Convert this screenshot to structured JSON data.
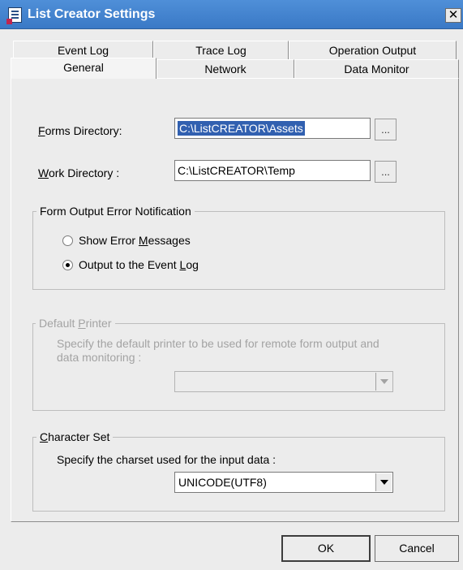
{
  "window": {
    "title": "List Creator Settings",
    "close_symbol": "✕"
  },
  "icons": {
    "app": "list-creator-app-icon",
    "close": "close-icon"
  },
  "tabs": {
    "row_back": [
      {
        "label": "Event Log"
      },
      {
        "label": "Trace Log"
      },
      {
        "label": "Operation Output"
      }
    ],
    "row_front": [
      {
        "label": "General",
        "active": true
      },
      {
        "label": "Network"
      },
      {
        "label": "Data Monitor"
      }
    ]
  },
  "general": {
    "forms_directory": {
      "label_accel": "F",
      "label_rest": "orms Directory:",
      "value": "C:\\ListCREATOR\\Assets",
      "browse": "..."
    },
    "work_directory": {
      "label_accel": "W",
      "label_rest": "ork Directory :",
      "value": "C:\\ListCREATOR\\Temp",
      "browse": "..."
    },
    "error_notification": {
      "title": "Form Output Error Notification",
      "options": [
        {
          "label_pre": "Show Error ",
          "accel": "M",
          "label_post": "essages",
          "checked": false
        },
        {
          "label_pre": "Output to the Event ",
          "accel": "L",
          "label_post": "og",
          "checked": true
        }
      ]
    },
    "default_printer": {
      "title_pre": "Default ",
      "title_accel": "P",
      "title_post": "rinter",
      "description_line1": "Specify the default printer to be used for remote form output and",
      "description_line2": "data monitoring :",
      "selected": "",
      "enabled": false
    },
    "character_set": {
      "title_accel": "C",
      "title_rest": "haracter Set",
      "description": "Specify the charset used for the input data :",
      "selected": "UNICODE(UTF8)"
    }
  },
  "buttons": {
    "ok": "OK",
    "cancel": "Cancel"
  },
  "colors": {
    "titlebar": "#3a79c6",
    "selection": "#3160b0",
    "disabled_text": "#a3a3a3"
  }
}
